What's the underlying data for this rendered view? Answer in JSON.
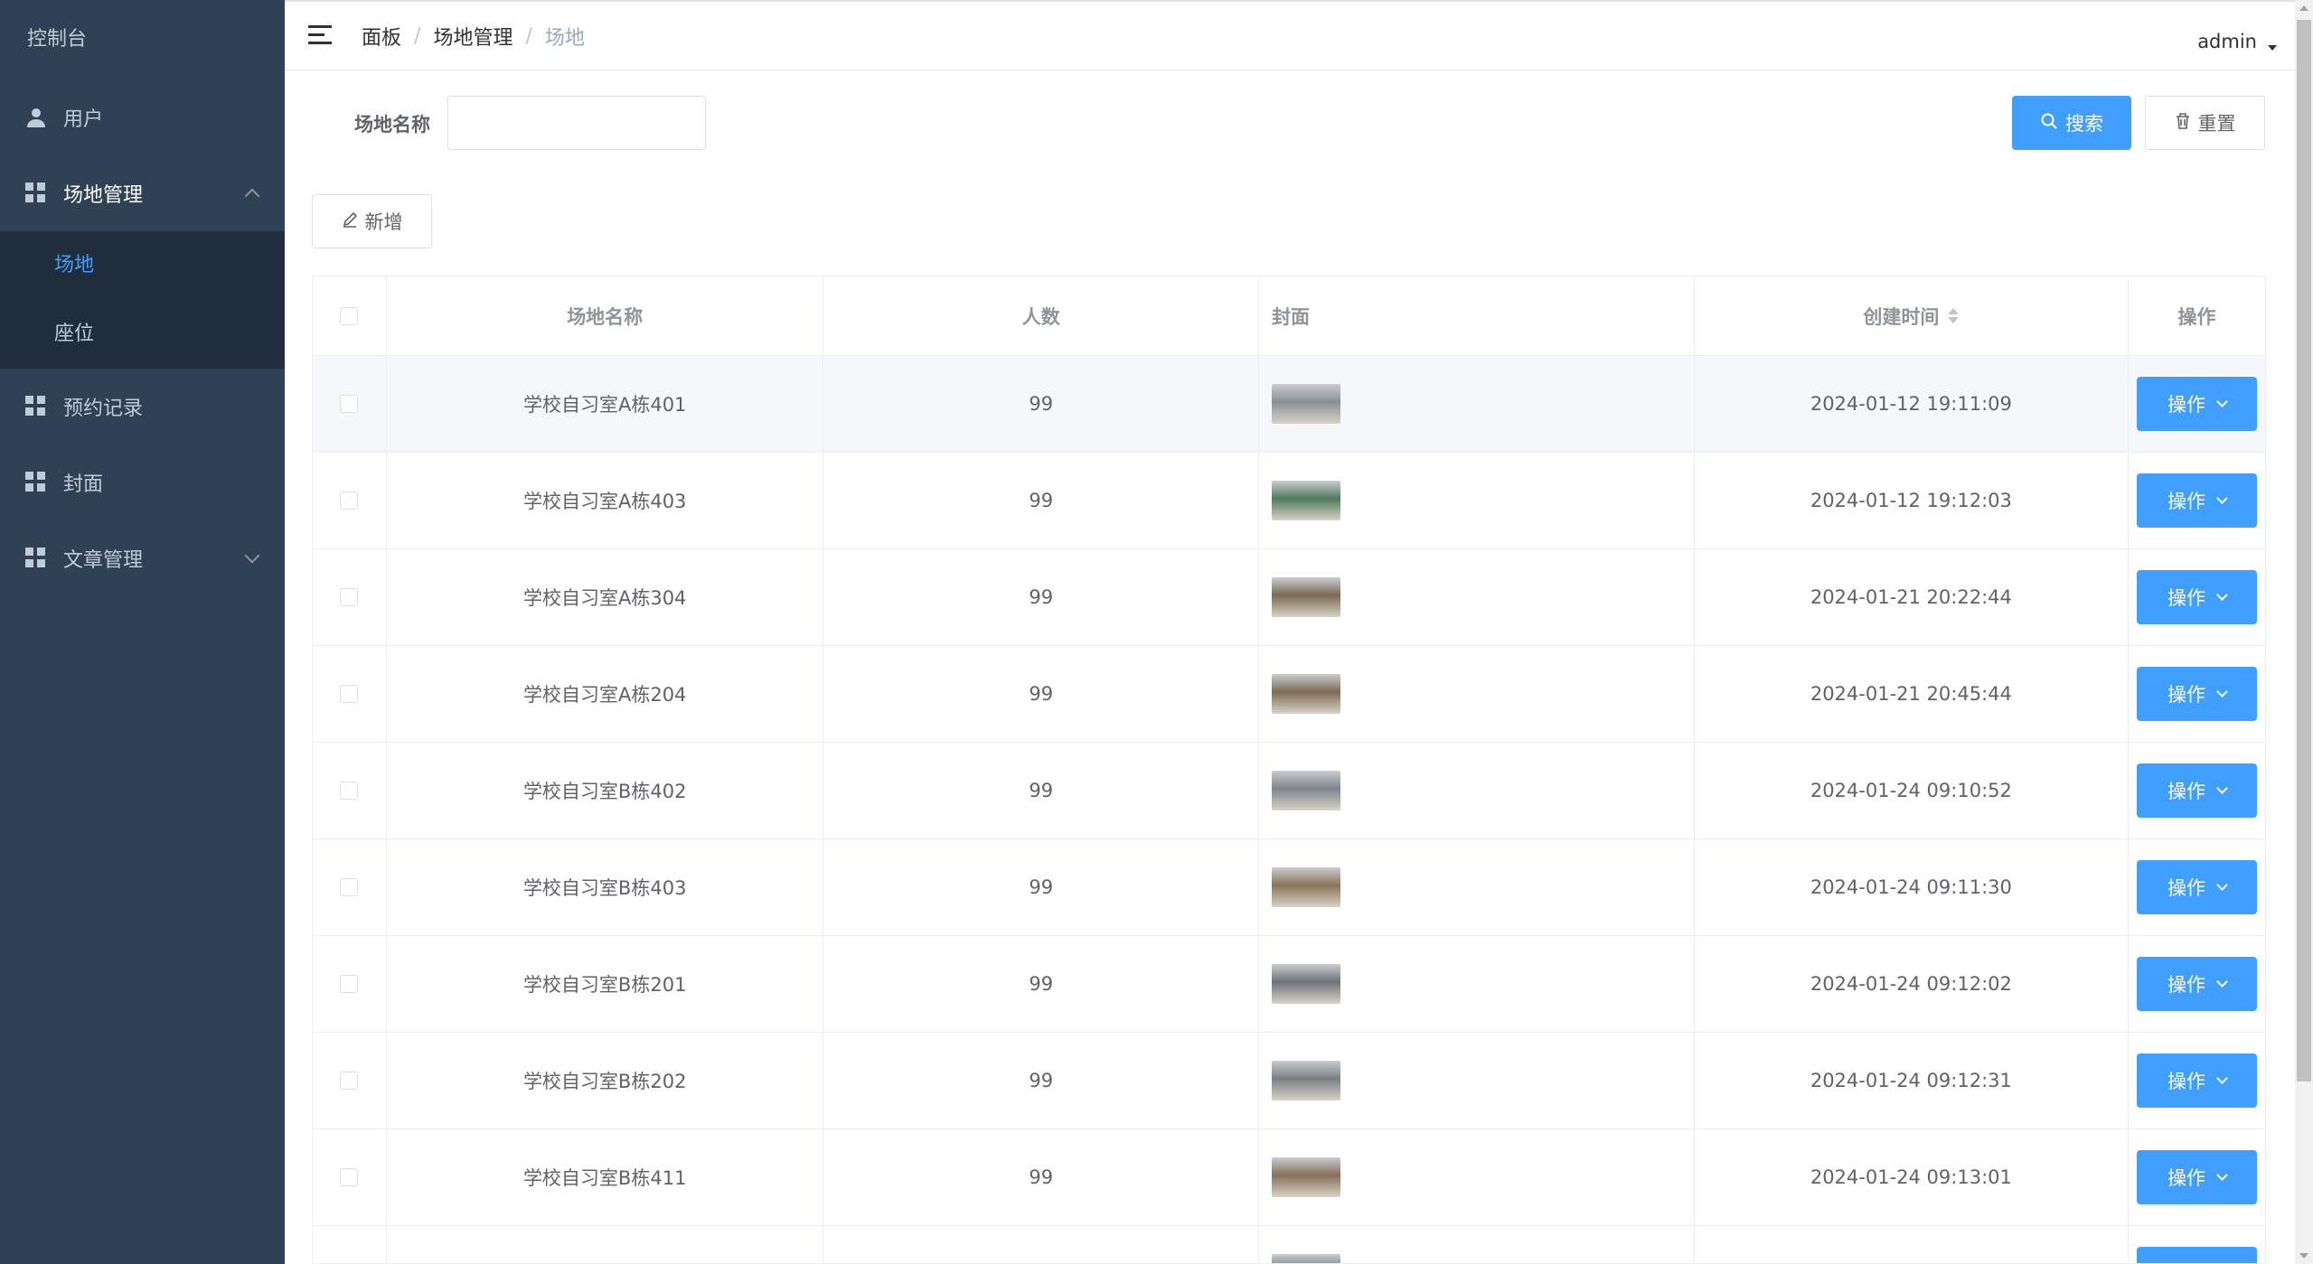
{
  "sidebar": {
    "title": "控制台",
    "items": [
      {
        "label": "用户",
        "icon": "user-icon"
      },
      {
        "label": "场地管理",
        "icon": "grid-icon",
        "expanded": true
      },
      {
        "label": "预约记录",
        "icon": "grid-icon"
      },
      {
        "label": "封面",
        "icon": "grid-icon"
      },
      {
        "label": "文章管理",
        "icon": "grid-icon",
        "expanded": false
      }
    ],
    "submenu": [
      {
        "label": "场地",
        "active": true
      },
      {
        "label": "座位",
        "active": false
      }
    ]
  },
  "header": {
    "breadcrumb": [
      "面板",
      "场地管理",
      "场地"
    ],
    "separator": "/",
    "user": "admin"
  },
  "search": {
    "label": "场地名称",
    "value": "",
    "search_button": "搜索",
    "reset_button": "重置"
  },
  "toolbar": {
    "add_button": "新增"
  },
  "table": {
    "columns": [
      "场地名称",
      "人数",
      "封面",
      "创建时间",
      "操作"
    ],
    "rows": [
      {
        "name": "学校自习室A栋401",
        "count": "99",
        "time": "2024-01-12 19:11:09",
        "action": "操作",
        "thumb": "#8a8f96"
      },
      {
        "name": "学校自习室A栋403",
        "count": "99",
        "time": "2024-01-12 19:12:03",
        "action": "操作",
        "thumb": "#4f7a5c"
      },
      {
        "name": "学校自习室A栋304",
        "count": "99",
        "time": "2024-01-21 20:22:44",
        "action": "操作",
        "thumb": "#7a6a52"
      },
      {
        "name": "学校自习室A栋204",
        "count": "99",
        "time": "2024-01-21 20:45:44",
        "action": "操作",
        "thumb": "#7d6b54"
      },
      {
        "name": "学校自习室B栋402",
        "count": "99",
        "time": "2024-01-24 09:10:52",
        "action": "操作",
        "thumb": "#7e858c"
      },
      {
        "name": "学校自习室B栋403",
        "count": "99",
        "time": "2024-01-24 09:11:30",
        "action": "操作",
        "thumb": "#8b7358"
      },
      {
        "name": "学校自习室B栋201",
        "count": "99",
        "time": "2024-01-24 09:12:02",
        "action": "操作",
        "thumb": "#6e7378"
      },
      {
        "name": "学校自习室B栋202",
        "count": "99",
        "time": "2024-01-24 09:12:31",
        "action": "操作",
        "thumb": "#7a7f84"
      },
      {
        "name": "学校自习室B栋411",
        "count": "99",
        "time": "2024-01-24 09:13:01",
        "action": "操作",
        "thumb": "#87705a"
      },
      {
        "name": "",
        "count": "",
        "time": "",
        "action": "",
        "thumb": "#6a6e72"
      }
    ]
  },
  "colors": {
    "sidebar_bg": "#304156",
    "submenu_bg": "#1f2d3d",
    "accent": "#409eff",
    "text": "#606266"
  }
}
